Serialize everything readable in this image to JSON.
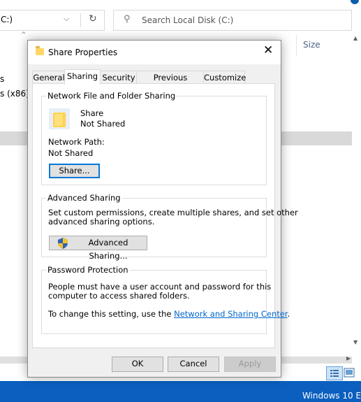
{
  "explorer": {
    "address_path": "C:)",
    "address_chevron": "⌵",
    "refresh_glyph": "↻",
    "search_icon_glyph": "⚲",
    "search_placeholder": "Search Local Disk (C:)",
    "column_size": "Size",
    "nav_item_1": "s",
    "nav_item_2": "s (x86)",
    "sort_caret": "^",
    "taskbar_watermark": "Windows 10 E"
  },
  "dialog": {
    "title": "Share Properties",
    "close_glyph": "✕",
    "tabs": [
      "General",
      "Sharing",
      "Security",
      "Previous Versions",
      "Customize"
    ],
    "active_tab": "Sharing",
    "network_sharing": {
      "group_title": "Network File and Folder Sharing",
      "name": "Share",
      "status": "Not Shared",
      "path_label": "Network Path:",
      "path_value": "Not Shared",
      "share_button": "Share..."
    },
    "advanced_sharing": {
      "group_title": "Advanced Sharing",
      "description_line1": "Set custom permissions, create multiple shares, and set other",
      "description_line2": "advanced sharing options.",
      "button": "Advanced Sharing..."
    },
    "password_protection": {
      "group_title": "Password Protection",
      "line1": "People must have a user account and password for this",
      "line2": "computer to access shared folders.",
      "change_prefix": "To change this setting, use the ",
      "link_text": "Network and Sharing Center",
      "change_suffix": "."
    },
    "buttons": {
      "ok": "OK",
      "cancel": "Cancel",
      "apply": "Apply"
    }
  },
  "colors": {
    "accent": "#0078d7",
    "taskbar": "#0a5fbf",
    "link": "#0066cc",
    "folder": "#ffd24d"
  }
}
